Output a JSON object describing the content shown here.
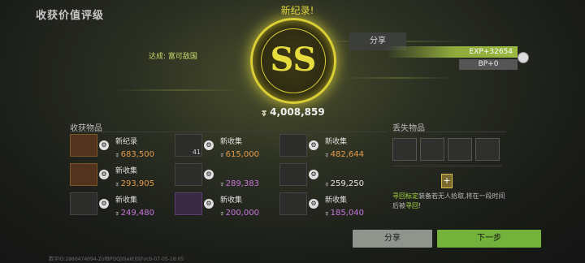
{
  "title": "收获价值评级",
  "new_record": "新纪录!",
  "achievement": {
    "prefix": "达成:",
    "text": "富可敌国"
  },
  "badge": {
    "grade": "SS"
  },
  "total": {
    "currency_icon": "ᢌ",
    "value": "4,008,859"
  },
  "top_share_label": "分享",
  "exp": "EXP+32654",
  "bp": "BP+0",
  "loot_section": "收获物品",
  "lost_section": "丢失物品",
  "loot_items": [
    {
      "label": "新纪录",
      "value": "683,500",
      "color": "orange",
      "thumb": "orange",
      "badge_icon": "gear-icon"
    },
    {
      "label": "新收集",
      "value": "615,000",
      "color": "orange",
      "thumb": "plain",
      "qty": "41",
      "badge_icon": "gear-icon"
    },
    {
      "label": "新收集",
      "value": "482,644",
      "color": "orange",
      "thumb": "plain",
      "badge_icon": "gear-icon"
    },
    {
      "label": "新收集",
      "value": "293,905",
      "color": "orange",
      "thumb": "orange",
      "badge_icon": "gear-icon"
    },
    {
      "label": "",
      "value": "289,383",
      "color": "purple",
      "thumb": "plain",
      "badge_icon": "gear-icon"
    },
    {
      "label": "",
      "value": "259,250",
      "color": "white",
      "thumb": "plain",
      "badge_icon": "gear-icon"
    },
    {
      "label": "新收集",
      "value": "249,480",
      "color": "purple",
      "thumb": "plain",
      "badge_icon": "gear-icon"
    },
    {
      "label": "新收集",
      "value": "200,000",
      "color": "purple",
      "thumb": "purple",
      "badge_icon": "gear-icon"
    },
    {
      "label": "新收集",
      "value": "185,040",
      "color": "purple",
      "thumb": "plain",
      "badge_icon": "gear-icon"
    }
  ],
  "lost_items": [
    "helmet-icon",
    "vest-icon",
    "rifle-icon",
    "backpack-icon"
  ],
  "recover_tip": {
    "hl1": "寻回标定",
    "text": "装备若无人拾取,将在一段时间后被",
    "hl2": "寻回",
    "end": "!"
  },
  "buttons": {
    "share": "分享",
    "next": "下一步"
  },
  "footer": "数字ID:2860474094-ZofBPOQ|0|ekt|0|Fvcb-07-05-18:05"
}
